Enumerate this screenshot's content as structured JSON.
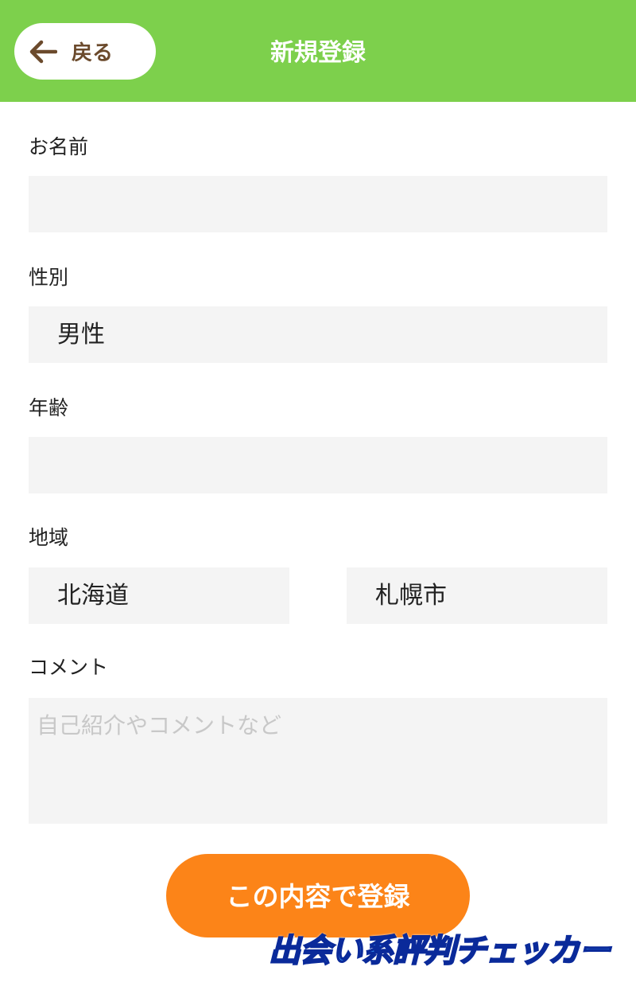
{
  "header": {
    "back_label": "戻る",
    "title": "新規登録",
    "background_color": "#7dd04c",
    "back_icon": "arrow-left-icon"
  },
  "form": {
    "name": {
      "label": "お名前",
      "value": ""
    },
    "gender": {
      "label": "性別",
      "value": "男性"
    },
    "age": {
      "label": "年齢",
      "value": ""
    },
    "region": {
      "label": "地域",
      "prefecture": "北海道",
      "city": "札幌市"
    },
    "comment": {
      "label": "コメント",
      "placeholder": "自己紹介やコメントなど",
      "value": ""
    }
  },
  "submit": {
    "label": "この内容で登録",
    "color": "#fc8418"
  },
  "watermark": {
    "text": "出会い系評判チェッカー"
  }
}
